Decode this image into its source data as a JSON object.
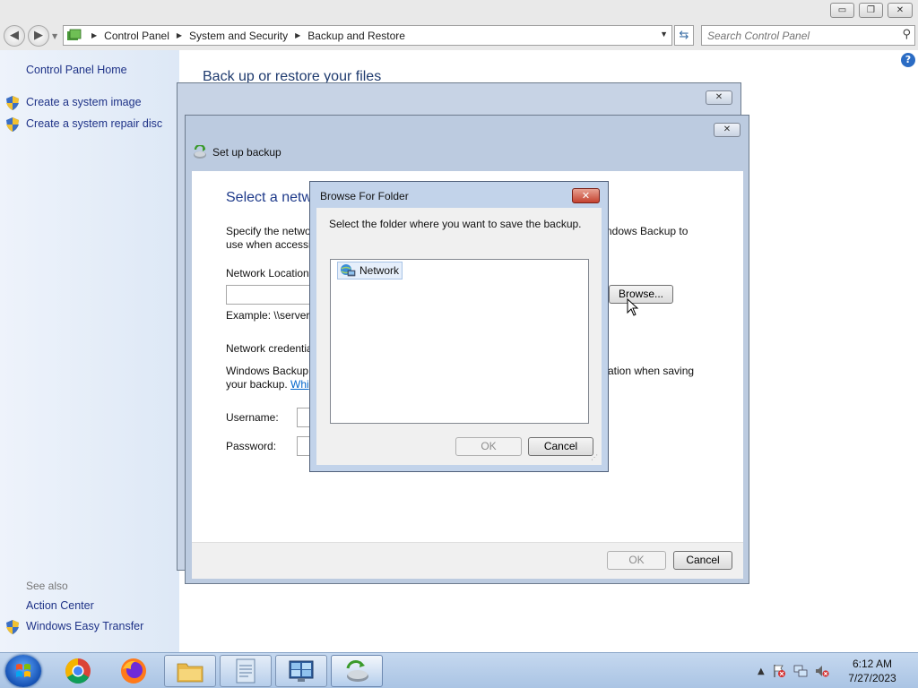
{
  "window": {
    "caption_buttons": {
      "minimize": "▭",
      "restore": "❐",
      "close": "✕"
    }
  },
  "address_bar": {
    "back_icon": "back-arrow-icon",
    "forward_icon": "forward-arrow-icon",
    "breadcrumbs": [
      "Control Panel",
      "System and Security",
      "Backup and Restore"
    ],
    "search_placeholder": "Search Control Panel"
  },
  "sidebar": {
    "home_label": "Control Panel Home",
    "tasks": [
      {
        "label": "Create a system image",
        "icon": "shield-icon"
      },
      {
        "label": "Create a system repair disc",
        "icon": "shield-icon"
      }
    ],
    "see_also_label": "See also",
    "see_also": [
      {
        "label": "Action Center"
      },
      {
        "label": "Windows Easy Transfer",
        "icon": "shield-icon"
      }
    ]
  },
  "main": {
    "heading": "Back up or restore your files",
    "help_glyph": "?"
  },
  "setup_dialog": {
    "title": "Set up backup",
    "section_title": "Select a netw",
    "desc_line1_left": "Specify the netwo",
    "desc_line1_right": "ndows Backup to",
    "desc_line2_left": "use when accessin",
    "network_location_label": "Network Location",
    "browse_button": "Browse...",
    "example_label": "Example: \\\\server\\",
    "credentials_label": "Network credentia",
    "cred_desc1_left": "Windows Backup",
    "cred_desc1_right": "ation when saving",
    "cred_desc2_left": "your backup.",
    "cred_link": "Whi",
    "username_label": "Username:",
    "password_label": "Password:",
    "ok_button": "OK",
    "cancel_button": "Cancel"
  },
  "browse_dialog": {
    "title": "Browse For Folder",
    "close_glyph": "✕",
    "instruction": "Select the folder where you want to save the backup.",
    "tree_items": [
      {
        "label": "Network",
        "icon": "network-icon",
        "selected": true
      }
    ],
    "ok_button": "OK",
    "cancel_button": "Cancel"
  },
  "taskbar": {
    "pinned": [
      {
        "name": "chrome",
        "icon": "chrome-icon"
      },
      {
        "name": "firefox",
        "icon": "firefox-icon"
      },
      {
        "name": "explorer",
        "icon": "folder-icon"
      },
      {
        "name": "notepad",
        "icon": "document-icon"
      },
      {
        "name": "control-panel",
        "icon": "control-panel-icon"
      },
      {
        "name": "backup",
        "icon": "backup-icon",
        "active": true
      }
    ],
    "tray_icons": [
      "show-hidden-icon",
      "action-center-flag-icon",
      "network-icon",
      "volume-muted-icon"
    ],
    "clock_time": "6:12 AM",
    "clock_date": "7/27/2023"
  }
}
